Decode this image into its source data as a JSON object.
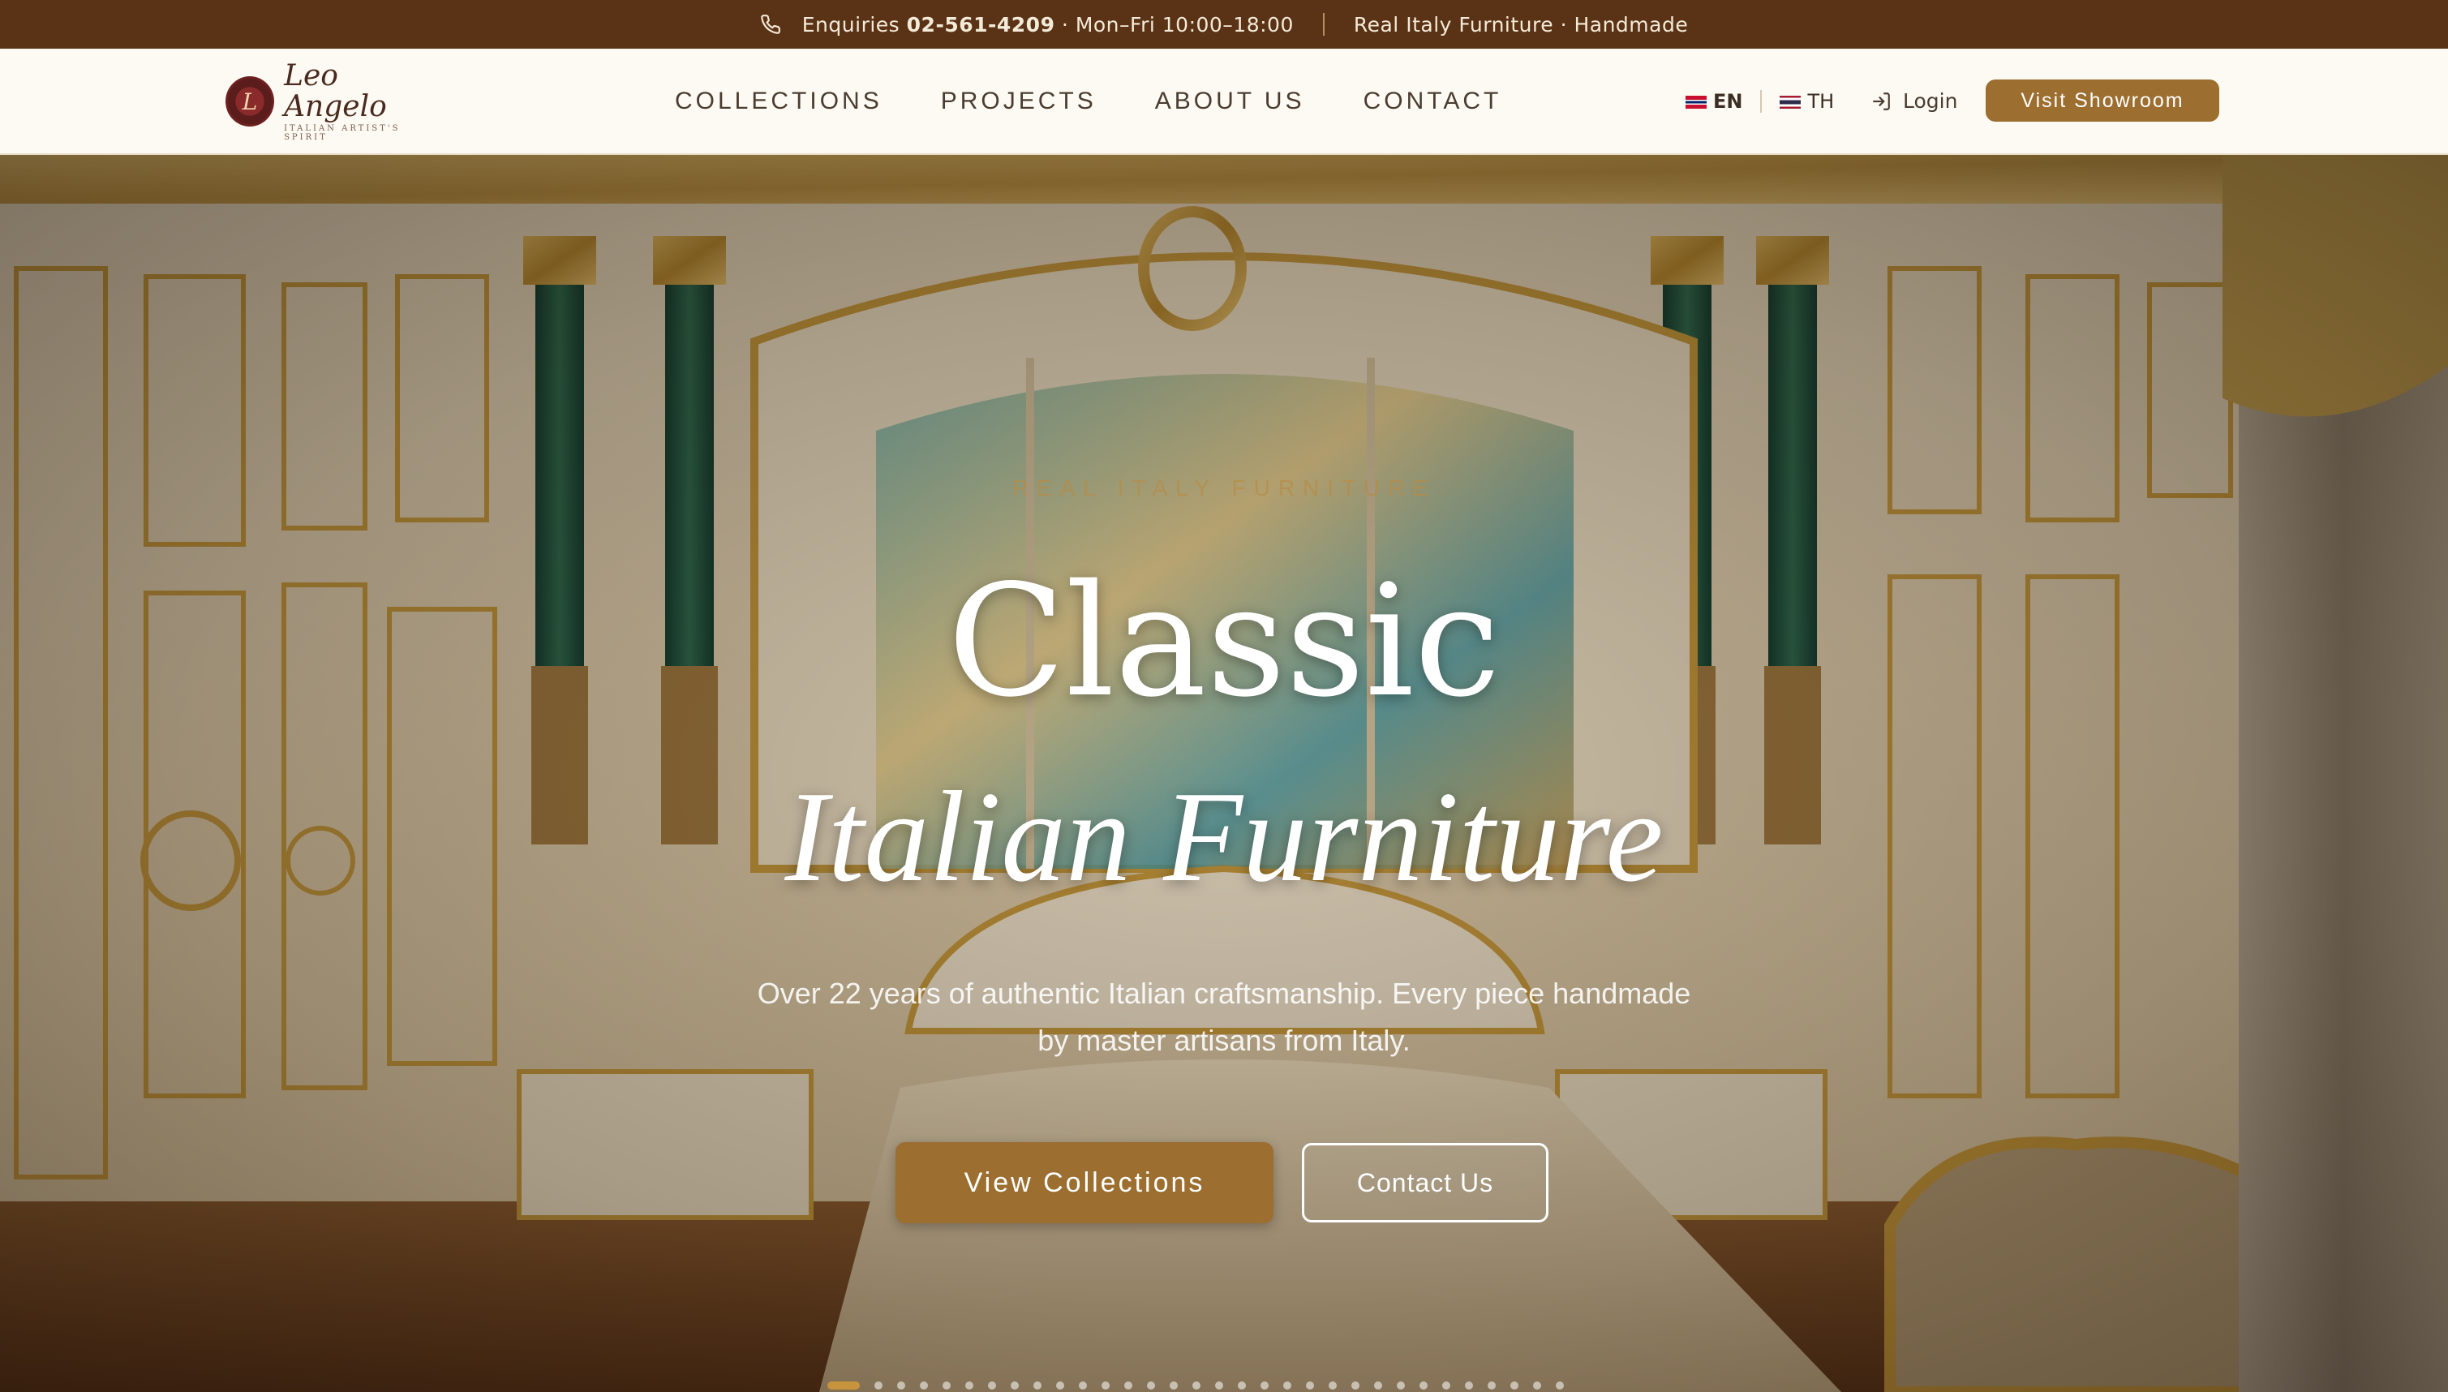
{
  "topbar": {
    "enquiries_label": "Enquiries",
    "phone": "02-561-4209",
    "hours": "· Mon–Fri 10:00–18:00",
    "tagline": "Real Italy Furniture · Handmade",
    "icon": "phone-icon"
  },
  "header": {
    "logo": {
      "name": "Leo Angelo",
      "tagline": "ITALIAN ARTIST'S SPIRIT",
      "mark": "L"
    },
    "nav": [
      {
        "label": "COLLECTIONS"
      },
      {
        "label": "PROJECTS"
      },
      {
        "label": "ABOUT US"
      },
      {
        "label": "CONTACT"
      }
    ],
    "languages": [
      {
        "code": "EN",
        "flag": "uk-flag-icon",
        "active": true
      },
      {
        "code": "TH",
        "flag": "thai-flag-icon",
        "active": false
      }
    ],
    "login_label": "Login",
    "showroom_button": "Visit Showroom"
  },
  "hero": {
    "eyebrow": "REAL ITALY FURNITURE",
    "title_line1": "Classic",
    "title_line2": "Italian Furniture",
    "subtitle": "Over 22 years of authentic Italian craftsmanship. Every piece handmade by master artisans from Italy.",
    "primary_button": "View Collections",
    "secondary_button": "Contact Us",
    "slide_count": 32,
    "active_slide": 1
  },
  "colors": {
    "topbar_bg": "#5a3215",
    "accent": "#9c6e2f",
    "header_bg": "#fdfaf3"
  }
}
